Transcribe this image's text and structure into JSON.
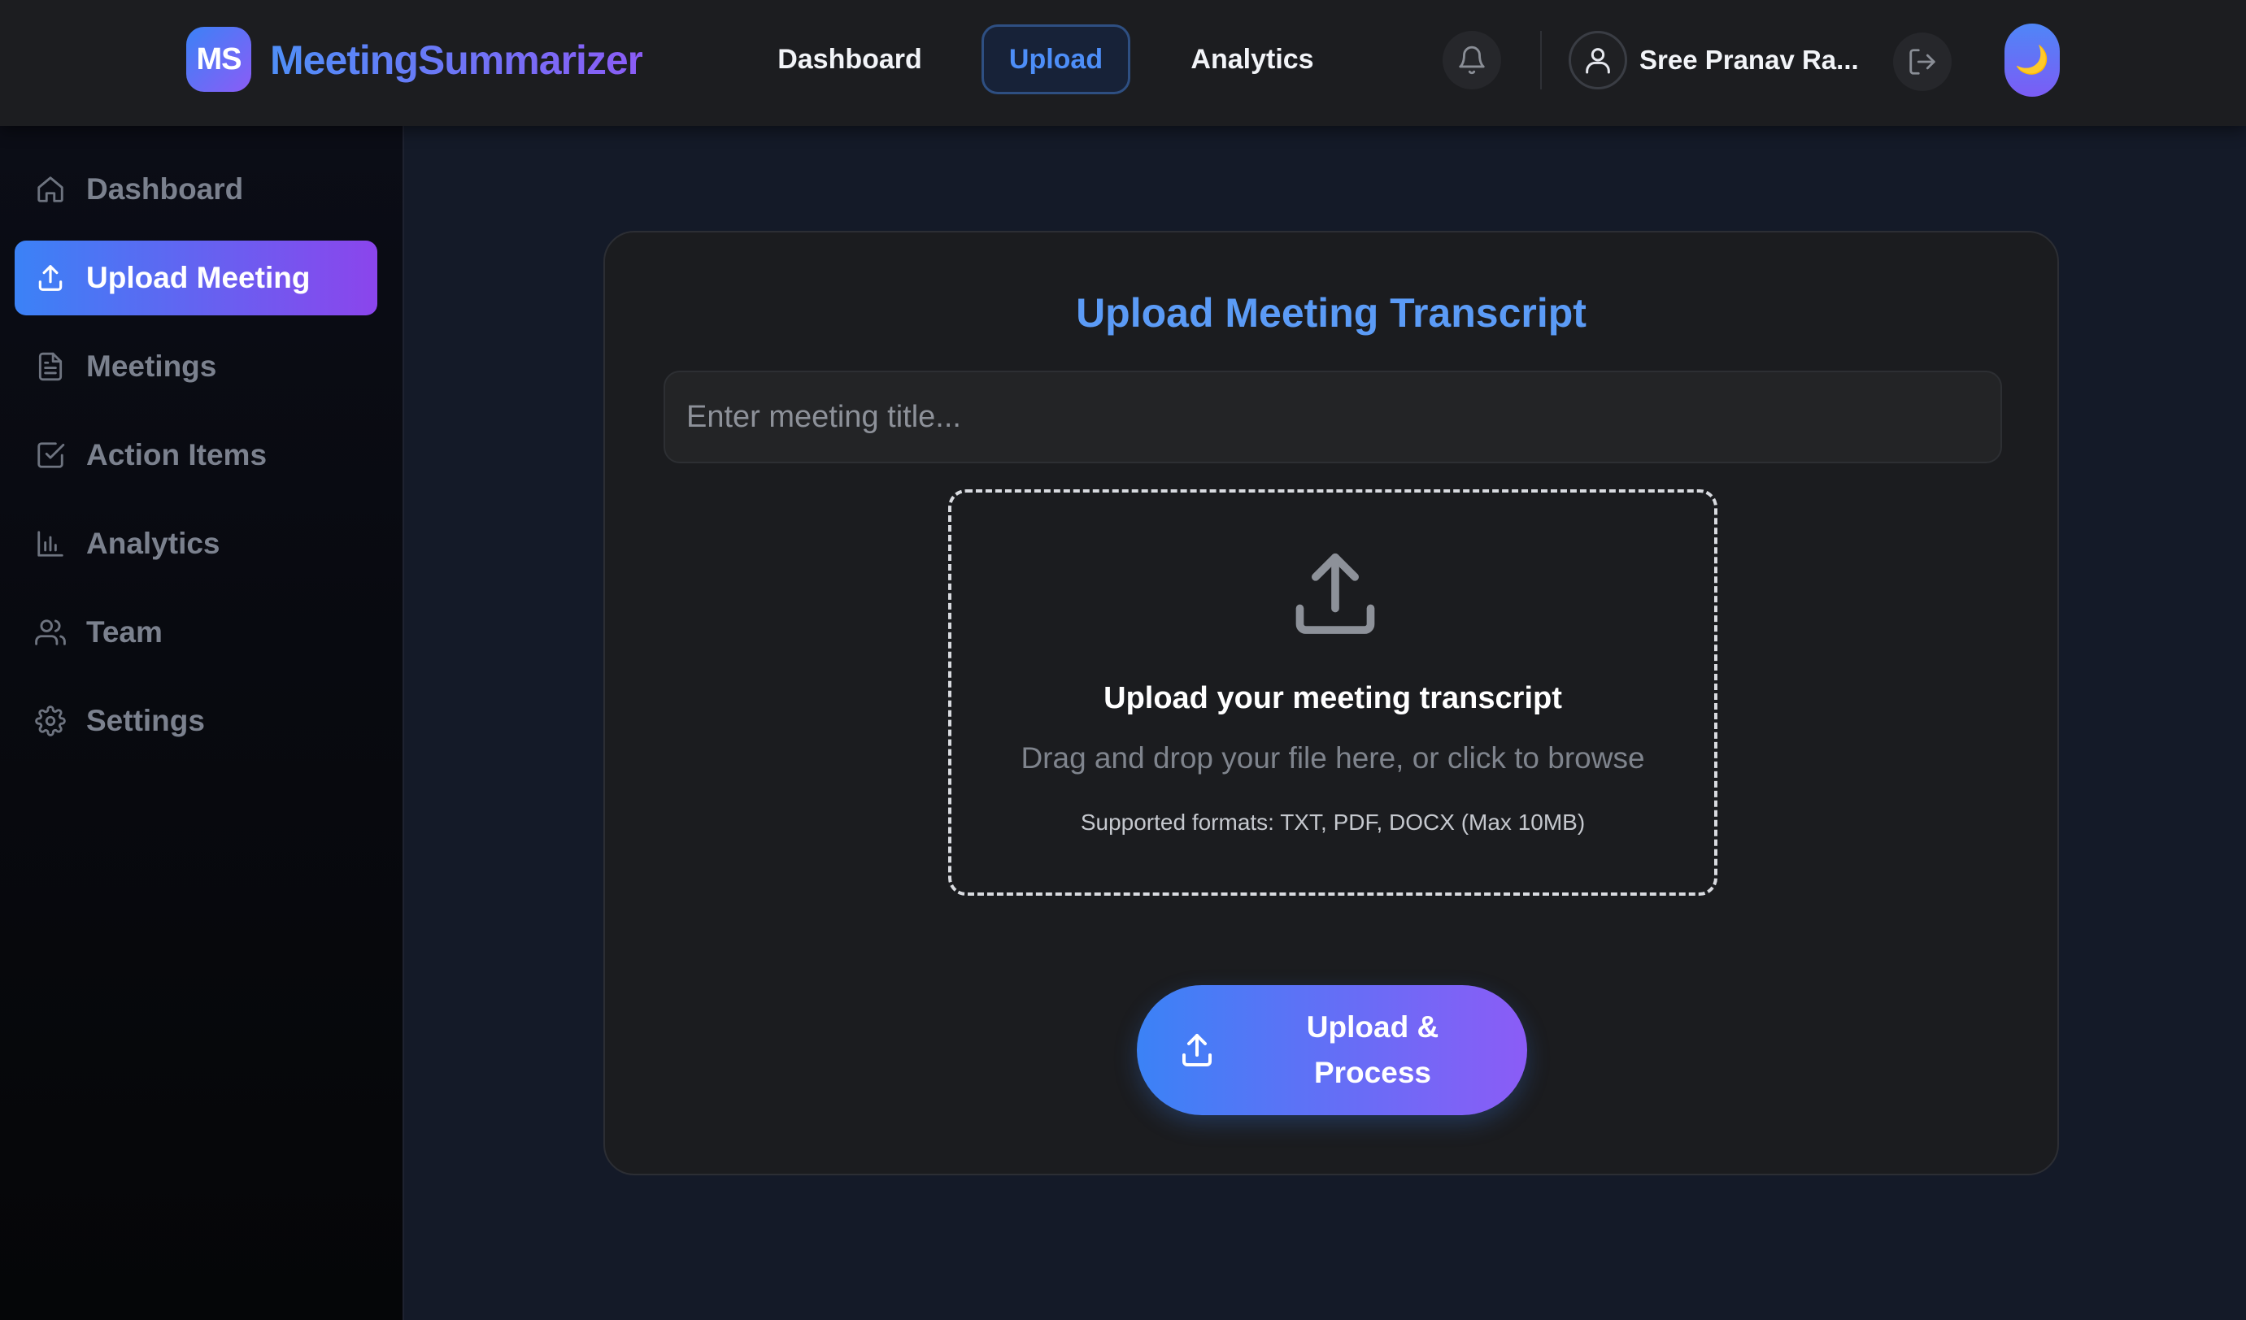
{
  "header": {
    "logo_initials": "MS",
    "brand_name": "MeetingSummarizer",
    "nav": [
      {
        "label": "Dashboard",
        "active": false
      },
      {
        "label": "Upload",
        "active": true
      },
      {
        "label": "Analytics",
        "active": false
      }
    ],
    "user_name": "Sree Pranav Ra...",
    "theme_toggle_glyph": "🌙",
    "icons": [
      "bell-icon",
      "user-icon",
      "logout-icon",
      "moon-icon"
    ]
  },
  "sidebar": {
    "items": [
      {
        "label": "Dashboard",
        "icon": "home-icon",
        "active": false
      },
      {
        "label": "Upload Meeting",
        "icon": "upload-icon",
        "active": true
      },
      {
        "label": "Meetings",
        "icon": "document-icon",
        "active": false
      },
      {
        "label": "Action Items",
        "icon": "checkbox-icon",
        "active": false
      },
      {
        "label": "Analytics",
        "icon": "bar-chart-icon",
        "active": false
      },
      {
        "label": "Team",
        "icon": "users-icon",
        "active": false
      },
      {
        "label": "Settings",
        "icon": "gear-icon",
        "active": false
      }
    ]
  },
  "main": {
    "title": "Upload Meeting Transcript",
    "title_input": {
      "value": "",
      "placeholder": "Enter meeting title..."
    },
    "dropzone": {
      "title": "Upload your meeting transcript",
      "subtitle": "Drag and drop your file here, or click to browse",
      "formats": "Supported formats: TXT, PDF, DOCX (Max 10MB)"
    },
    "submit_button": {
      "line1": "Upload &",
      "line2": "Process"
    }
  },
  "colors": {
    "accent_blue": "#3b82f6",
    "accent_purple": "#8b5cf6",
    "title_blue": "#5b9bf6",
    "background": "#141a28",
    "card": "#1b1c1f"
  }
}
